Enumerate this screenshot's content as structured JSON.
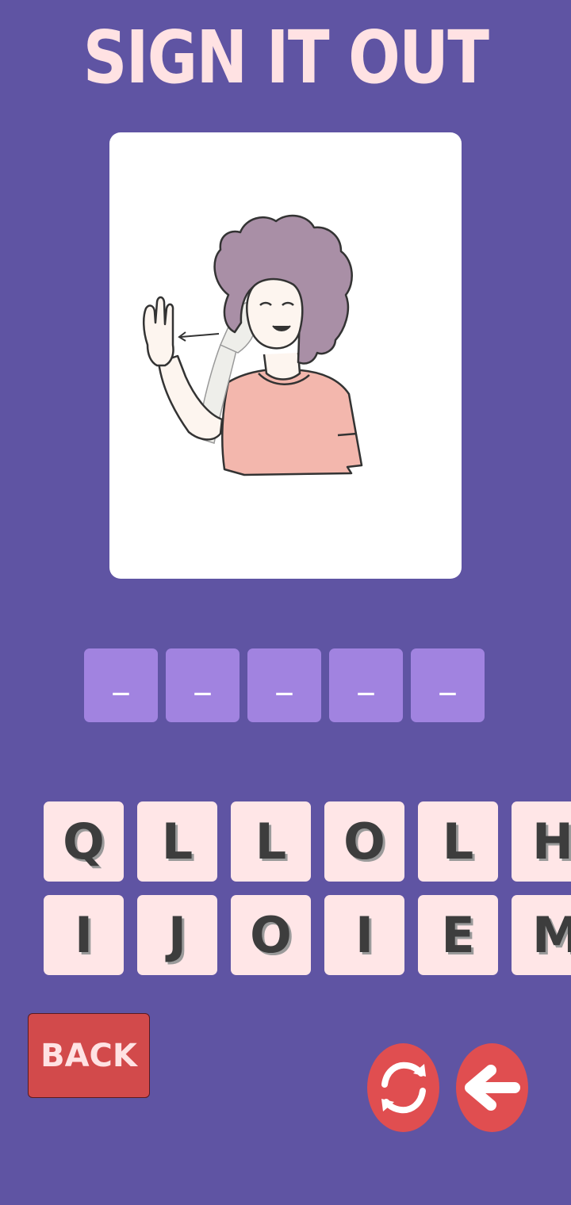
{
  "title": "SIGN IT OUT",
  "answer_slots": [
    "_",
    "_",
    "_",
    "_",
    "_"
  ],
  "keyboard": {
    "row1": [
      "Q",
      "L",
      "L",
      "O",
      "L",
      "H"
    ],
    "row2": [
      "I",
      "J",
      "O",
      "I",
      "E",
      "M"
    ]
  },
  "back_label": "BACK",
  "icons": {
    "shuffle": "refresh-icon",
    "delete": "arrow-left-icon"
  },
  "colors": {
    "background": "#5f54a3",
    "title": "#ffe2e3",
    "slot": "#a183e0",
    "key": "#ffe6e7",
    "button": "#d24a4b"
  }
}
